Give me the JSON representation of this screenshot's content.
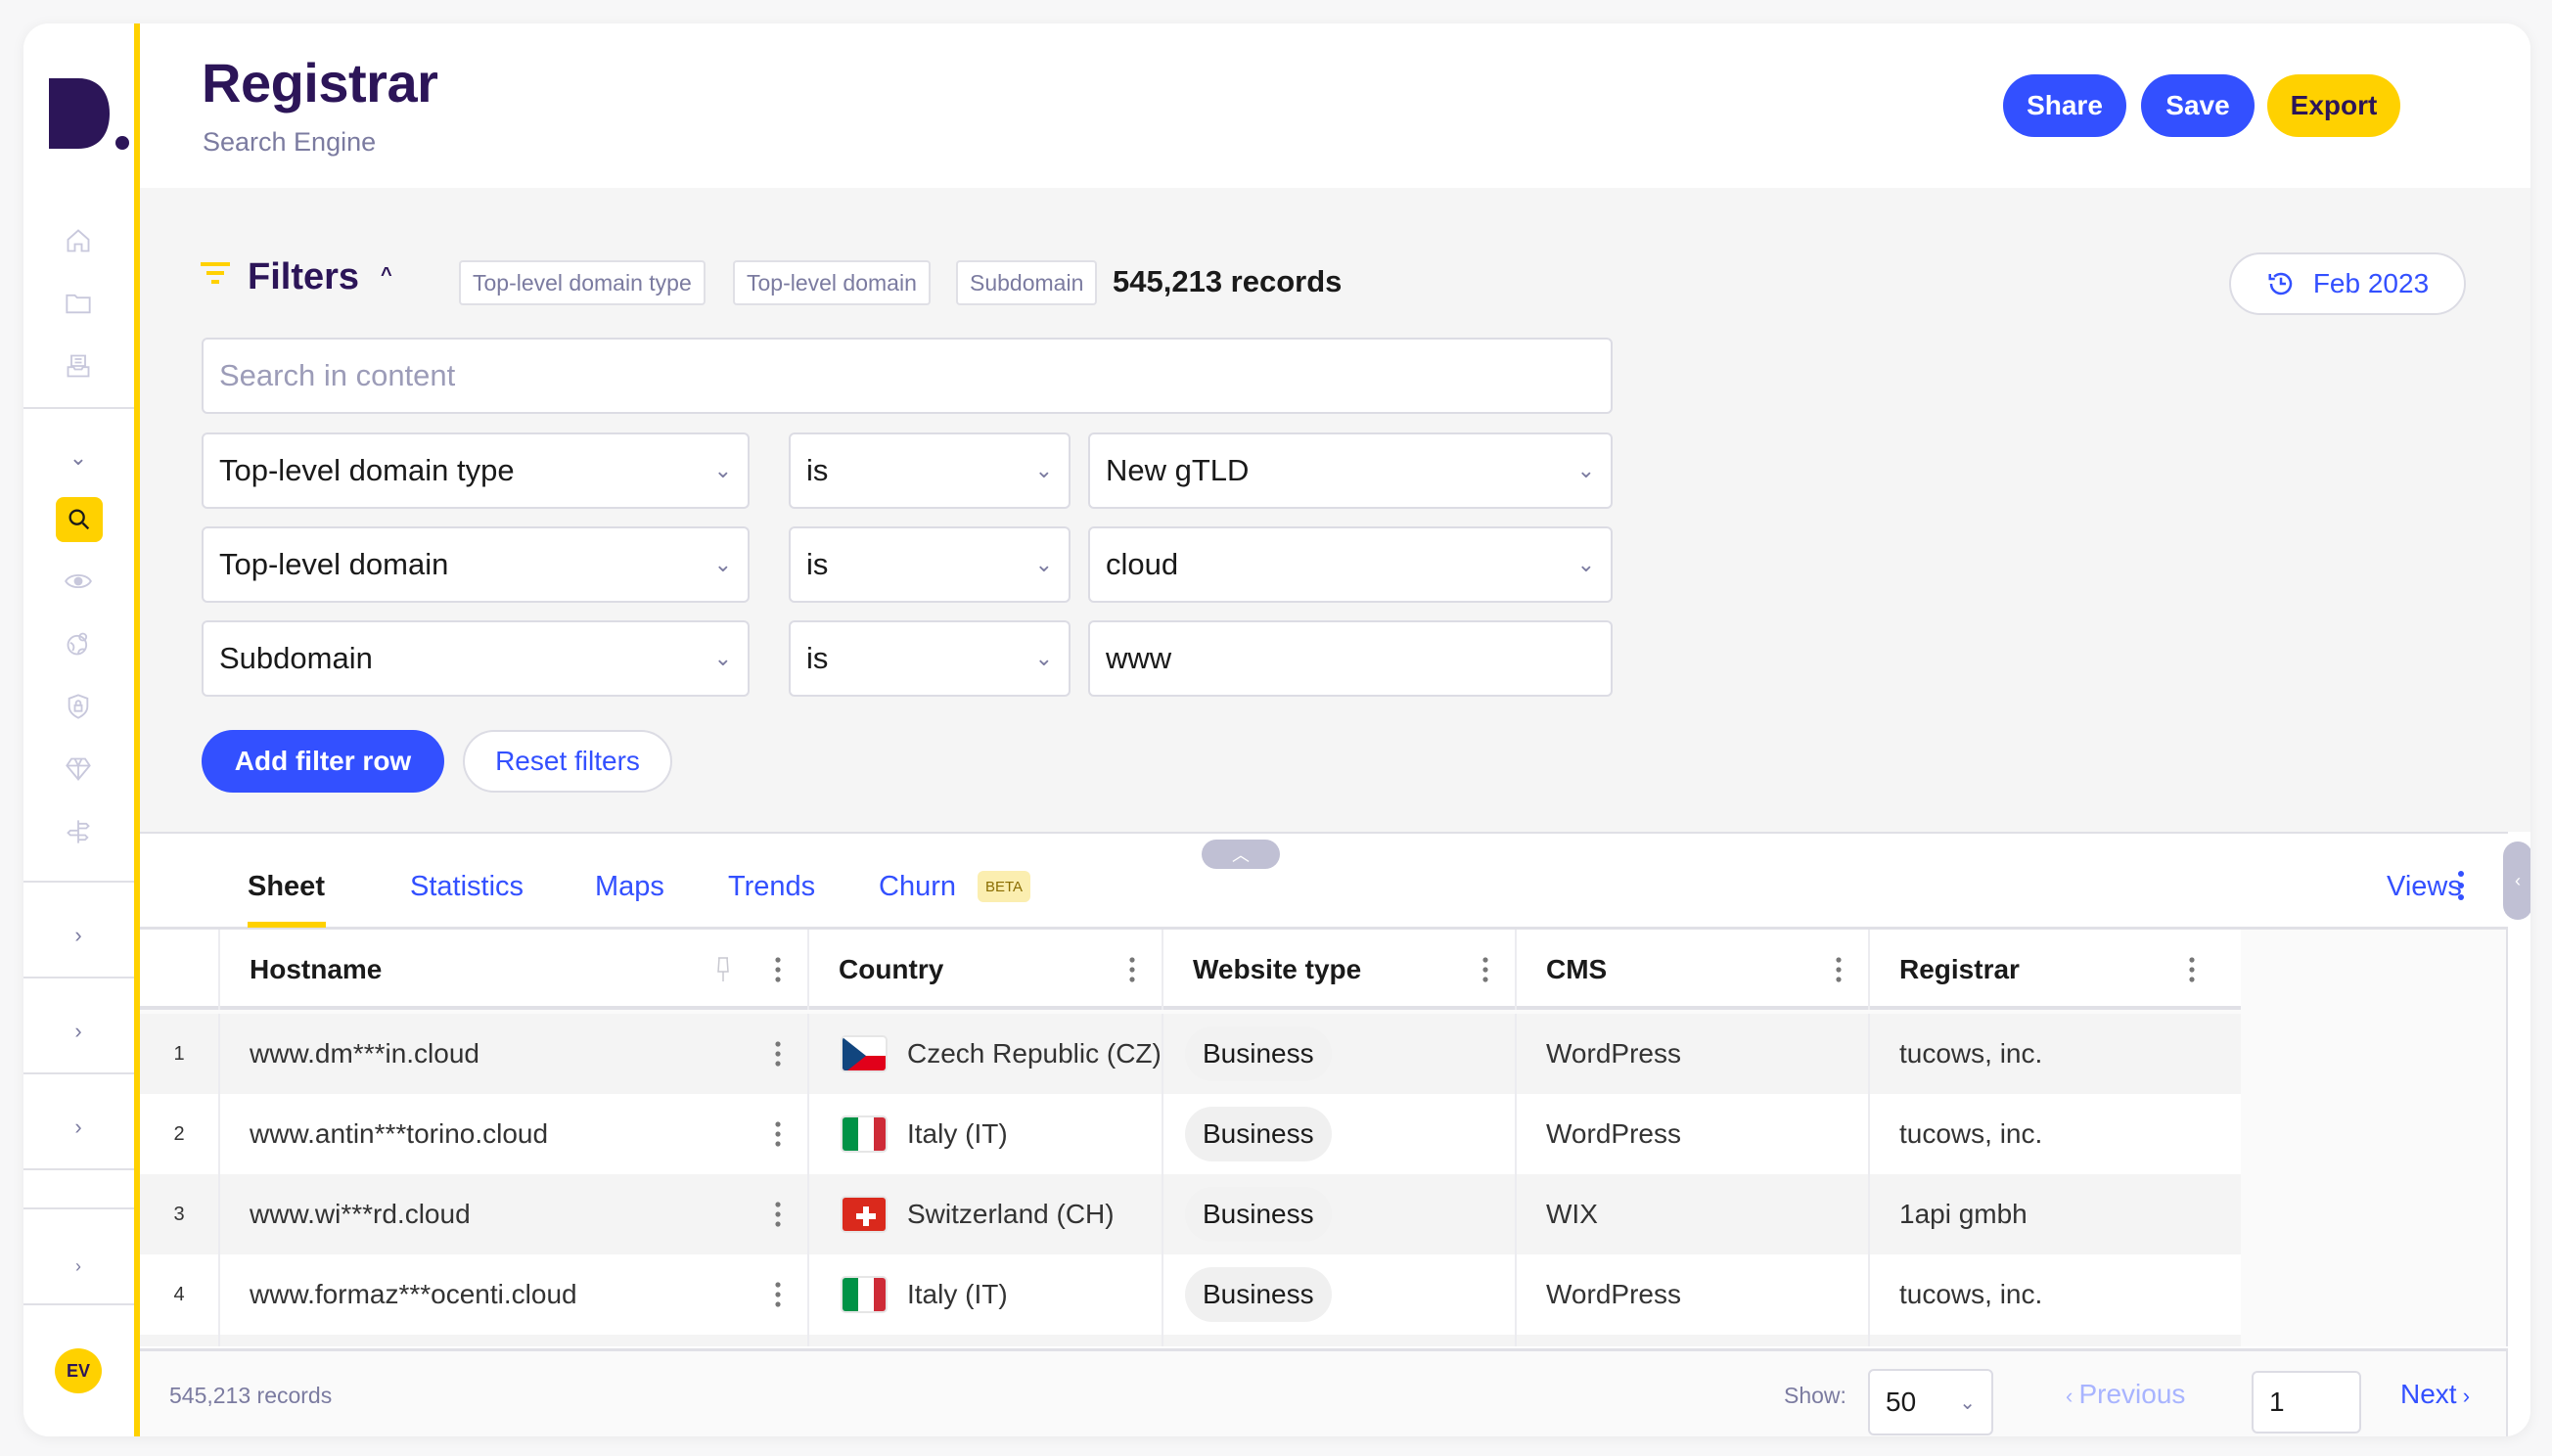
{
  "app": {
    "title": "Registrar",
    "subtitle": "Search Engine",
    "logo_text": "D.",
    "colors": {
      "brand_dark": "#2c1558",
      "accent_blue": "#3350ff",
      "accent_yellow": "#ffd100"
    }
  },
  "header": {
    "share_label": "Share",
    "save_label": "Save",
    "export_label": "Export"
  },
  "sidebar": {
    "top_icons": [
      "home-icon",
      "folder-icon",
      "inbox-icon"
    ],
    "tool_icons": [
      "search-icon",
      "eye-icon",
      "globe-user-icon",
      "shield-lock-icon",
      "diamond-icon",
      "signpost-icon"
    ],
    "active_tool": "search-icon",
    "avatar_initials": "EV"
  },
  "filters": {
    "title": "Filters",
    "chips": [
      "Top-level domain type",
      "Top-level domain",
      "Subdomain"
    ],
    "records_count": "545,213 records",
    "date_label": "Feb 2023",
    "search_placeholder": "Search in content",
    "rows": [
      {
        "field": "Top-level domain type",
        "operator": "is",
        "value": "New gTLD",
        "value_is_select": true
      },
      {
        "field": "Top-level domain",
        "operator": "is",
        "value": "cloud",
        "value_is_select": true
      },
      {
        "field": "Subdomain",
        "operator": "is",
        "value": "www",
        "value_is_select": false
      }
    ],
    "add_row_label": "Add filter row",
    "reset_label": "Reset filters"
  },
  "tabs": {
    "items": [
      {
        "label": "Sheet",
        "active": true
      },
      {
        "label": "Statistics",
        "active": false
      },
      {
        "label": "Maps",
        "active": false
      },
      {
        "label": "Trends",
        "active": false
      },
      {
        "label": "Churn",
        "active": false,
        "badge": "BETA"
      }
    ],
    "views_label": "Views"
  },
  "table": {
    "columns": [
      "Hostname",
      "Country",
      "Website type",
      "CMS",
      "Registrar"
    ],
    "rows": [
      {
        "num": "1",
        "hostname": "www.dm***in.cloud",
        "country": "Czech Republic (CZ)",
        "flag": "cz",
        "website_type": "Business",
        "cms": "WordPress",
        "registrar": "tucows, inc."
      },
      {
        "num": "2",
        "hostname": "www.antin***torino.cloud",
        "country": "Italy (IT)",
        "flag": "it",
        "website_type": "Business",
        "cms": "WordPress",
        "registrar": "tucows, inc."
      },
      {
        "num": "3",
        "hostname": "www.wi***rd.cloud",
        "country": "Switzerland (CH)",
        "flag": "ch",
        "website_type": "Business",
        "cms": "WIX",
        "registrar": "1api gmbh"
      },
      {
        "num": "4",
        "hostname": "www.formaz***ocenti.cloud",
        "country": "Italy (IT)",
        "flag": "it",
        "website_type": "Business",
        "cms": "WordPress",
        "registrar": "tucows, inc."
      }
    ]
  },
  "footer": {
    "records": "545,213 records",
    "show_label": "Show:",
    "page_size": "50",
    "previous_label": "Previous",
    "page_value": "1",
    "next_label": "Next"
  }
}
